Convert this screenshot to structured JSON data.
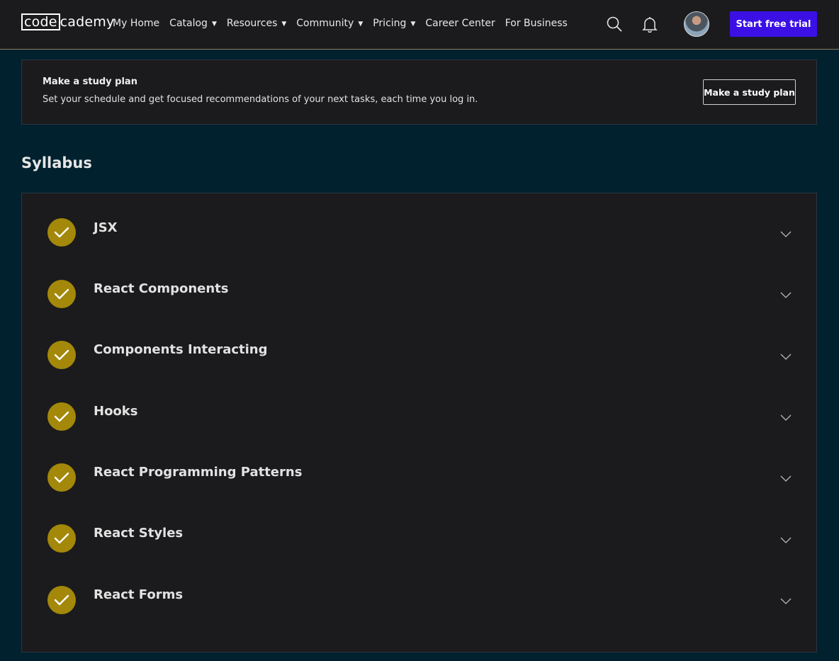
{
  "header": {
    "logo": {
      "boxed": "code",
      "rest": "cademy"
    },
    "nav": [
      {
        "label": "My Home",
        "dropdown": false
      },
      {
        "label": "Catalog",
        "dropdown": true
      },
      {
        "label": "Resources",
        "dropdown": true
      },
      {
        "label": "Community",
        "dropdown": true
      },
      {
        "label": "Pricing",
        "dropdown": true
      },
      {
        "label": "Career Center",
        "dropdown": false
      },
      {
        "label": "For Business",
        "dropdown": false
      }
    ],
    "icons": [
      "search-icon",
      "bell-icon"
    ],
    "cta_label": "Start free trial",
    "cta_color": "#3a10e5"
  },
  "study_plan": {
    "title": "Make a study plan",
    "description": "Set your schedule and get focused recommendations of your next tasks, each time you log in.",
    "button_label": "Make a study plan"
  },
  "syllabus": {
    "heading": "Syllabus",
    "check_color": "#a3880a",
    "modules": [
      {
        "title": "JSX",
        "completed": true
      },
      {
        "title": "React Components",
        "completed": true
      },
      {
        "title": "Components Interacting",
        "completed": true
      },
      {
        "title": "Hooks",
        "completed": true
      },
      {
        "title": "React Programming Patterns",
        "completed": true
      },
      {
        "title": "React Styles",
        "completed": true
      },
      {
        "title": "React Forms",
        "completed": true
      }
    ]
  }
}
